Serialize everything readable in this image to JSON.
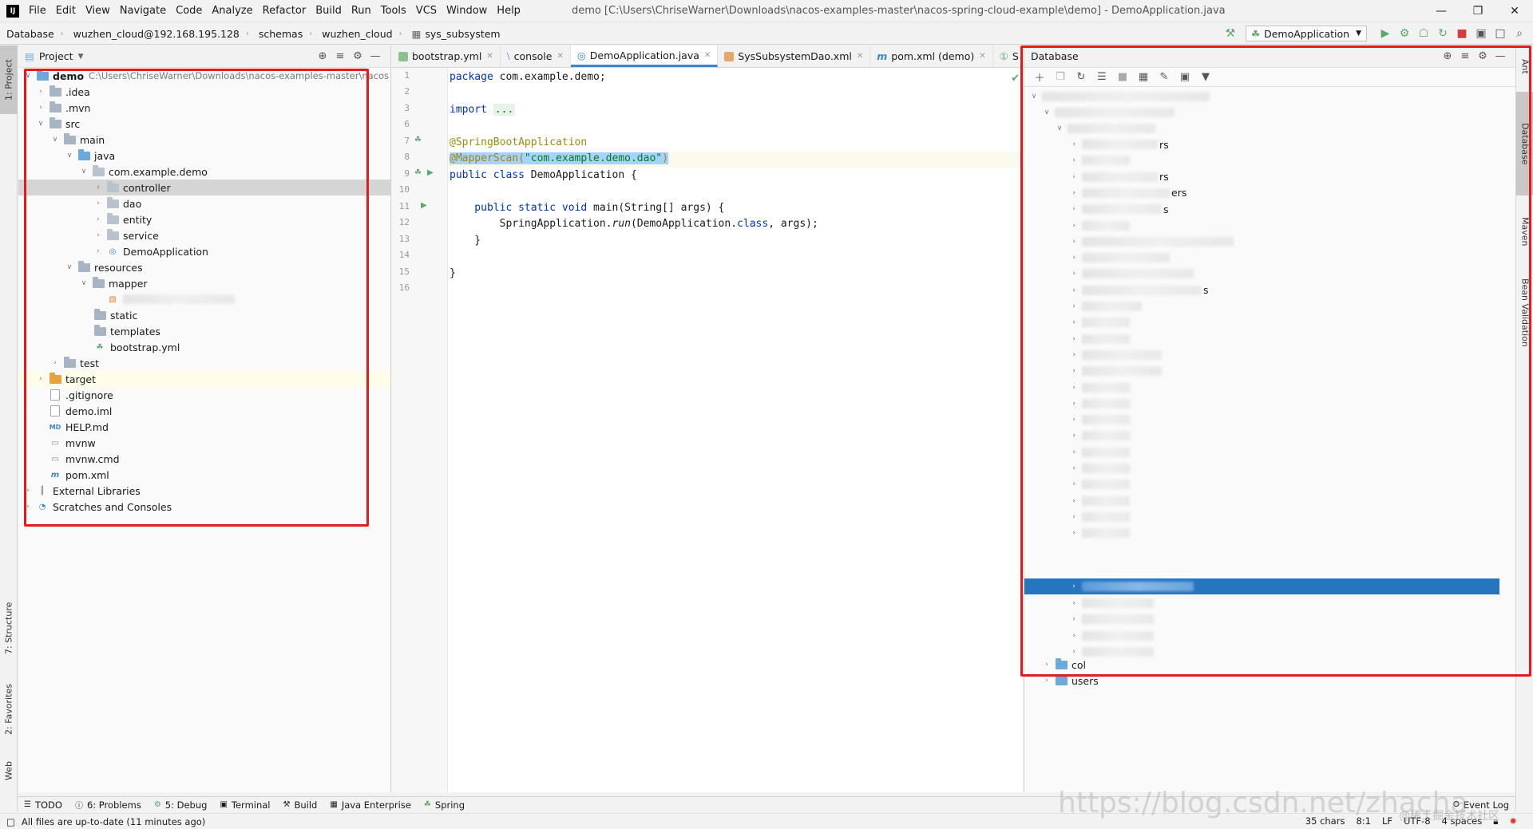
{
  "menu": {
    "items": [
      "File",
      "Edit",
      "View",
      "Navigate",
      "Code",
      "Analyze",
      "Refactor",
      "Build",
      "Run",
      "Tools",
      "VCS",
      "Window",
      "Help"
    ],
    "title": "demo [C:\\Users\\ChriseWarner\\Downloads\\nacos-examples-master\\nacos-spring-cloud-example\\demo] - DemoApplication.java"
  },
  "breadcrumb": [
    "Database",
    "wuzhen_cloud@192.168.195.128",
    "schemas",
    "wuzhen_cloud",
    "sys_subsystem"
  ],
  "run_config": "DemoApplication",
  "left_stripe": {
    "project": "1: Project",
    "structure": "7: Structure",
    "favorites": "2: Favorites",
    "web": "Web"
  },
  "right_stripe": {
    "ant": "Ant",
    "database": "Database",
    "maven": "Maven",
    "bean": "Bean Validation"
  },
  "project_panel": {
    "title": "Project",
    "root_name": "demo",
    "root_path": "C:\\Users\\ChriseWarner\\Downloads\\nacos-examples-master\\nacos",
    "items": {
      "idea": ".idea",
      "mvn": ".mvn",
      "src": "src",
      "main": "main",
      "java": "java",
      "pkg": "com.example.demo",
      "controller": "controller",
      "dao": "dao",
      "entity": "entity",
      "service": "service",
      "app": "DemoApplication",
      "resources": "resources",
      "mapper": "mapper",
      "static": "static",
      "templates": "templates",
      "bootstrap": "bootstrap.yml",
      "test": "test",
      "target": "target",
      "gitignore": ".gitignore",
      "iml": "demo.iml",
      "help": "HELP.md",
      "mvnw": "mvnw",
      "mvnwcmd": "mvnw.cmd",
      "pom": "pom.xml",
      "libs": "External Libraries",
      "scratches": "Scratches and Consoles"
    }
  },
  "editor": {
    "tabs": [
      "bootstrap.yml",
      "console",
      "DemoApplication.java",
      "SysSubsystemDao.xml",
      "pom.xml (demo)",
      "S"
    ],
    "active_tab": 2,
    "line_numbers": [
      "1",
      "2",
      "3",
      "6",
      "7",
      "8",
      "9",
      "10",
      "11",
      "12",
      "13",
      "14",
      "15",
      "16"
    ],
    "code": {
      "l1a": "package",
      "l1b": " com.example.demo;",
      "l3a": "import",
      "l3b": "...",
      "l7": "@SpringBootApplication",
      "l8a": "@MapperScan(",
      "l8b": "\"com.example.demo.dao\"",
      "l8c": ")",
      "l9a": "public class",
      "l9b": " DemoApplication {",
      "l11a": "    public static void",
      "l11b": " main(String[] args) {",
      "l12a": "        SpringApplication.",
      "l12b": "run",
      "l12c": "(DemoApplication.",
      "l12d": "class",
      "l12e": ", args);",
      "l13": "    }",
      "l15": "}"
    }
  },
  "db_panel": {
    "title": "Database",
    "visible_items": {
      "col": "col",
      "users": "users",
      "s1": "rs",
      "s2": "rs",
      "s3": "ers",
      "s4": "s",
      "s5": "s"
    }
  },
  "bottom_tools": [
    "TODO",
    "6: Problems",
    "5: Debug",
    "Terminal",
    "Build",
    "Java Enterprise",
    "Spring",
    "Event Log"
  ],
  "status": {
    "message": "All files are up-to-date (11 minutes ago)",
    "chars": "35 chars",
    "pos": "8:1",
    "lf": "LF",
    "enc": "UTF-8",
    "indent": "4 spaces"
  },
  "watermark": {
    "main": "https://blog.csdn.net/zhacha",
    "small": "@稀土掘金技术社区"
  },
  "colors": {
    "accent": "#2675bf",
    "annotation_red": "#e8191b",
    "annotation": "#9e880d",
    "keyword": "#0033b3",
    "string": "#067d17"
  }
}
